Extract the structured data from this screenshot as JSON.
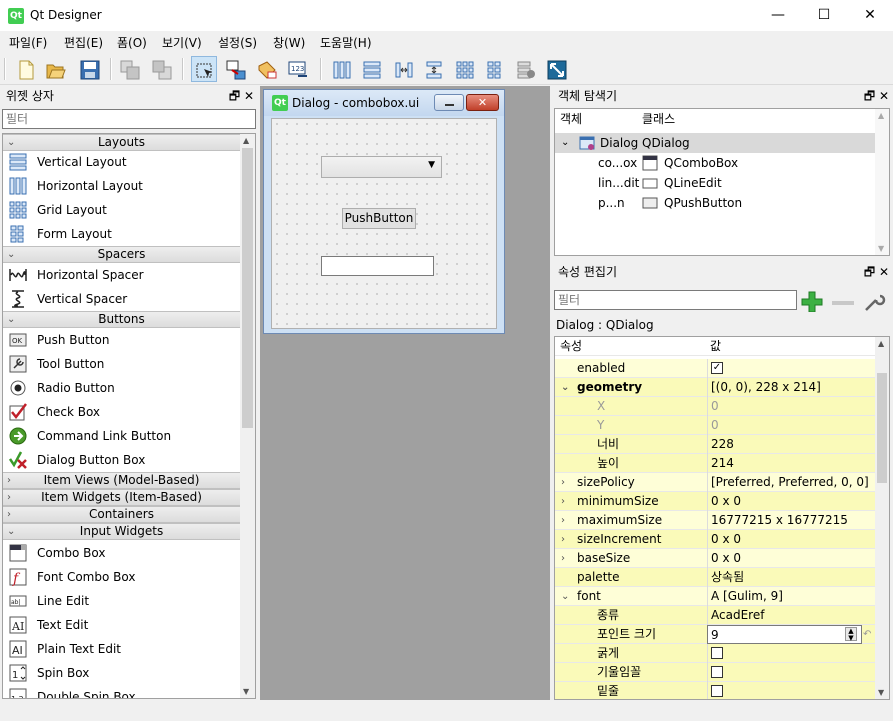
{
  "window": {
    "title": "Qt Designer",
    "app_icon": "Qt",
    "minimize": "—",
    "maximize": "☐",
    "close": "✕"
  },
  "menu": [
    "파일(F)",
    "편집(E)",
    "폼(O)",
    "보기(V)",
    "설정(S)",
    "창(W)",
    "도움말(H)"
  ],
  "toolbar": [
    "new-file-icon",
    "open-file-icon",
    "save-icon",
    "send-to-back-icon",
    "bring-to-front-icon",
    "edit-widgets-icon",
    "edit-signals-slots-icon",
    "edit-buddies-icon",
    "edit-tab-order-icon",
    "lay-out-horizontally-icon",
    "lay-out-vertically-icon",
    "horizontal-splitter-icon",
    "vertical-splitter-icon",
    "grid-layout-icon",
    "form-layout-icon",
    "break-layout-icon",
    "adjust-size-icon"
  ],
  "widget_box": {
    "title": "위젯 상자",
    "filter_placeholder": "필터",
    "categories": {
      "layouts": "Layouts",
      "spacers": "Spacers",
      "buttons": "Buttons",
      "item_views": "Item Views (Model-Based)",
      "item_widgets": "Item Widgets (Item-Based)",
      "containers": "Containers",
      "input_widgets": "Input Widgets"
    },
    "layouts": [
      "Vertical Layout",
      "Horizontal Layout",
      "Grid Layout",
      "Form Layout"
    ],
    "spacers": [
      "Horizontal Spacer",
      "Vertical Spacer"
    ],
    "buttons": [
      "Push Button",
      "Tool Button",
      "Radio Button",
      "Check Box",
      "Command Link Button",
      "Dialog Button Box"
    ],
    "inputs": [
      "Combo Box",
      "Font Combo Box",
      "Line Edit",
      "Text Edit",
      "Plain Text Edit",
      "Spin Box",
      "Double Spin Box"
    ]
  },
  "form": {
    "title": "Dialog - combobox.ui",
    "icon": "Qt",
    "push_button": "PushButton"
  },
  "object_inspector": {
    "title": "객체 탐색기",
    "col_object": "객체",
    "col_class": "클래스",
    "rows": [
      {
        "object": "Dialog",
        "class": "QDialog"
      },
      {
        "object": "co...ox",
        "class": "QComboBox"
      },
      {
        "object": "lin...dit",
        "class": "QLineEdit"
      },
      {
        "object": "p...n",
        "class": "QPushButton"
      }
    ]
  },
  "property_editor": {
    "title": "속성 편집기",
    "filter_placeholder": "필터",
    "context": "Dialog : QDialog",
    "col_property": "속성",
    "col_value": "값",
    "rows": [
      {
        "name": "enabled",
        "value": "",
        "check": "✓"
      },
      {
        "name": "geometry",
        "value": "[(0, 0), 228 x 214]"
      },
      {
        "name": "X",
        "value": "0"
      },
      {
        "name": "Y",
        "value": "0"
      },
      {
        "name": "너비",
        "value": "228"
      },
      {
        "name": "높이",
        "value": "214"
      },
      {
        "name": "sizePolicy",
        "value": "[Preferred, Preferred, 0, 0]"
      },
      {
        "name": "minimumSize",
        "value": "0 x 0"
      },
      {
        "name": "maximumSize",
        "value": "16777215 x 16777215"
      },
      {
        "name": "sizeIncrement",
        "value": "0 x 0"
      },
      {
        "name": "baseSize",
        "value": "0 x 0"
      },
      {
        "name": "palette",
        "value": "상속됨"
      },
      {
        "name": "font",
        "value": "A  [Gulim, 9]"
      },
      {
        "name": "종류",
        "value": "AcadEref"
      },
      {
        "name": "포인트 크기",
        "value": "9"
      },
      {
        "name": "굵게",
        "value": "",
        "check": ""
      },
      {
        "name": "기울임꼴",
        "value": "",
        "check": ""
      },
      {
        "name": "밑줄",
        "value": "",
        "check": ""
      }
    ]
  }
}
